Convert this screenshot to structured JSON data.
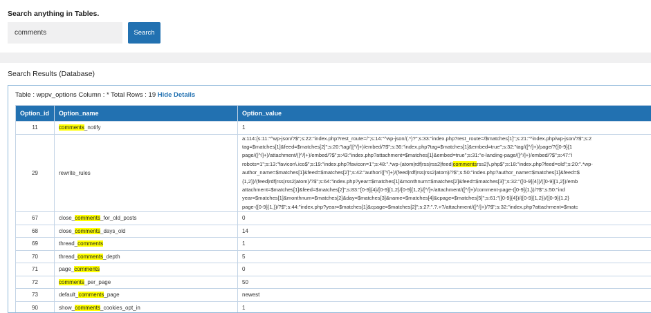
{
  "search": {
    "heading": "Search anything in Tables.",
    "value": "comments",
    "placeholder": "",
    "button_label": "Search"
  },
  "results": {
    "title": "Search Results (Database)",
    "info_text": "Table : wppv_options Column : * Total Rows : 19 ",
    "hide_details": "Hide Details",
    "highlight_term": "comments",
    "columns": [
      "Option_id",
      "Option_name",
      "Option_value"
    ],
    "rows": [
      {
        "id": "11",
        "name": "comments_notify",
        "value": "1"
      },
      {
        "id": "29",
        "name": "rewrite_rules",
        "value": "a:114:{s:11:\"^wp-json/?$\";s:22:\"index.php?rest_route=/\";s:14:\"^wp-json/(.*)?\";s:33:\"index.php?rest_route=/$matches[1]\";s:21:\"^index.php/wp-json/?$\";s:2\ntag=$matches[1]&feed=$matches[2]\";s:20:\"tag/([^/]+)/embed/?$\";s:36:\"index.php?tag=$matches[1]&embed=true\";s:32:\"tag/([^/]+)/page/?([0-9]{1\npage/([^/]+)/attachment/([^/]+)/embed/?$\";s:43:\"index.php?attachment=$matches[1]&embed=true\";s:31:\"e-landing-page/([^/]+)/embed/?$\";s:47:\"i\nrobots=1\";s:13:\"favicon\\.ico$\";s:19:\"index.php?favicon=1\";s:48:\".*wp-(atom|rdf|rss|rss2|feed|commentsrss2)\\.php$\";s:18:\"index.php?feed=old\";s:20:\".*wp-\nauthor_name=$matches[1]&feed=$matches[2]\";s:42:\"author/([^/]+)/(feed|rdf|rss|rss2|atom)/?$\";s:50:\"index.php?author_name=$matches[1]&feed=$\n{1,2})/(feed|rdf|rss|rss2|atom)/?$\";s:64:\"index.php?year=$matches[1]&monthnum=$matches[2]&feed=$matches[3]\";s:32:\"([0-9]{4})/([0-9]{1,2})/emb\nattachment=$matches[1]&feed=$matches[2]\";s:83:\"[0-9]{4}/[0-9]{1,2}/[0-9]{1,2}/[^/]+/attachment/([^/]+)/comment-page-([0-9]{1,})/?$\";s:50:\"ind\nyear=$matches[1]&monthnum=$matches[2]&day=$matches[3]&name=$matches[4]&cpage=$matches[5]\";s:61:\"([0-9]{4})/([0-9]{1,2})/([0-9]{1,2}\npage-([0-9]{1,})/?$\";s:44:\"index.php?year=$matches[1]&cpage=$matches[2]\";s:27:\".?.+?/attachment/([^/]+)/?$\";s:32:\"index.php?attachment=$matc"
      },
      {
        "id": "67",
        "name": "close_comments_for_old_posts",
        "value": "0"
      },
      {
        "id": "68",
        "name": "close_comments_days_old",
        "value": "14"
      },
      {
        "id": "69",
        "name": "thread_comments",
        "value": "1"
      },
      {
        "id": "70",
        "name": "thread_comments_depth",
        "value": "5"
      },
      {
        "id": "71",
        "name": "page_comments",
        "value": "0"
      },
      {
        "id": "72",
        "name": "comments_per_page",
        "value": "50"
      },
      {
        "id": "73",
        "name": "default_comments_page",
        "value": "newest"
      },
      {
        "id": "90",
        "name": "show_comments_cookies_opt_in",
        "value": "1"
      }
    ]
  }
}
